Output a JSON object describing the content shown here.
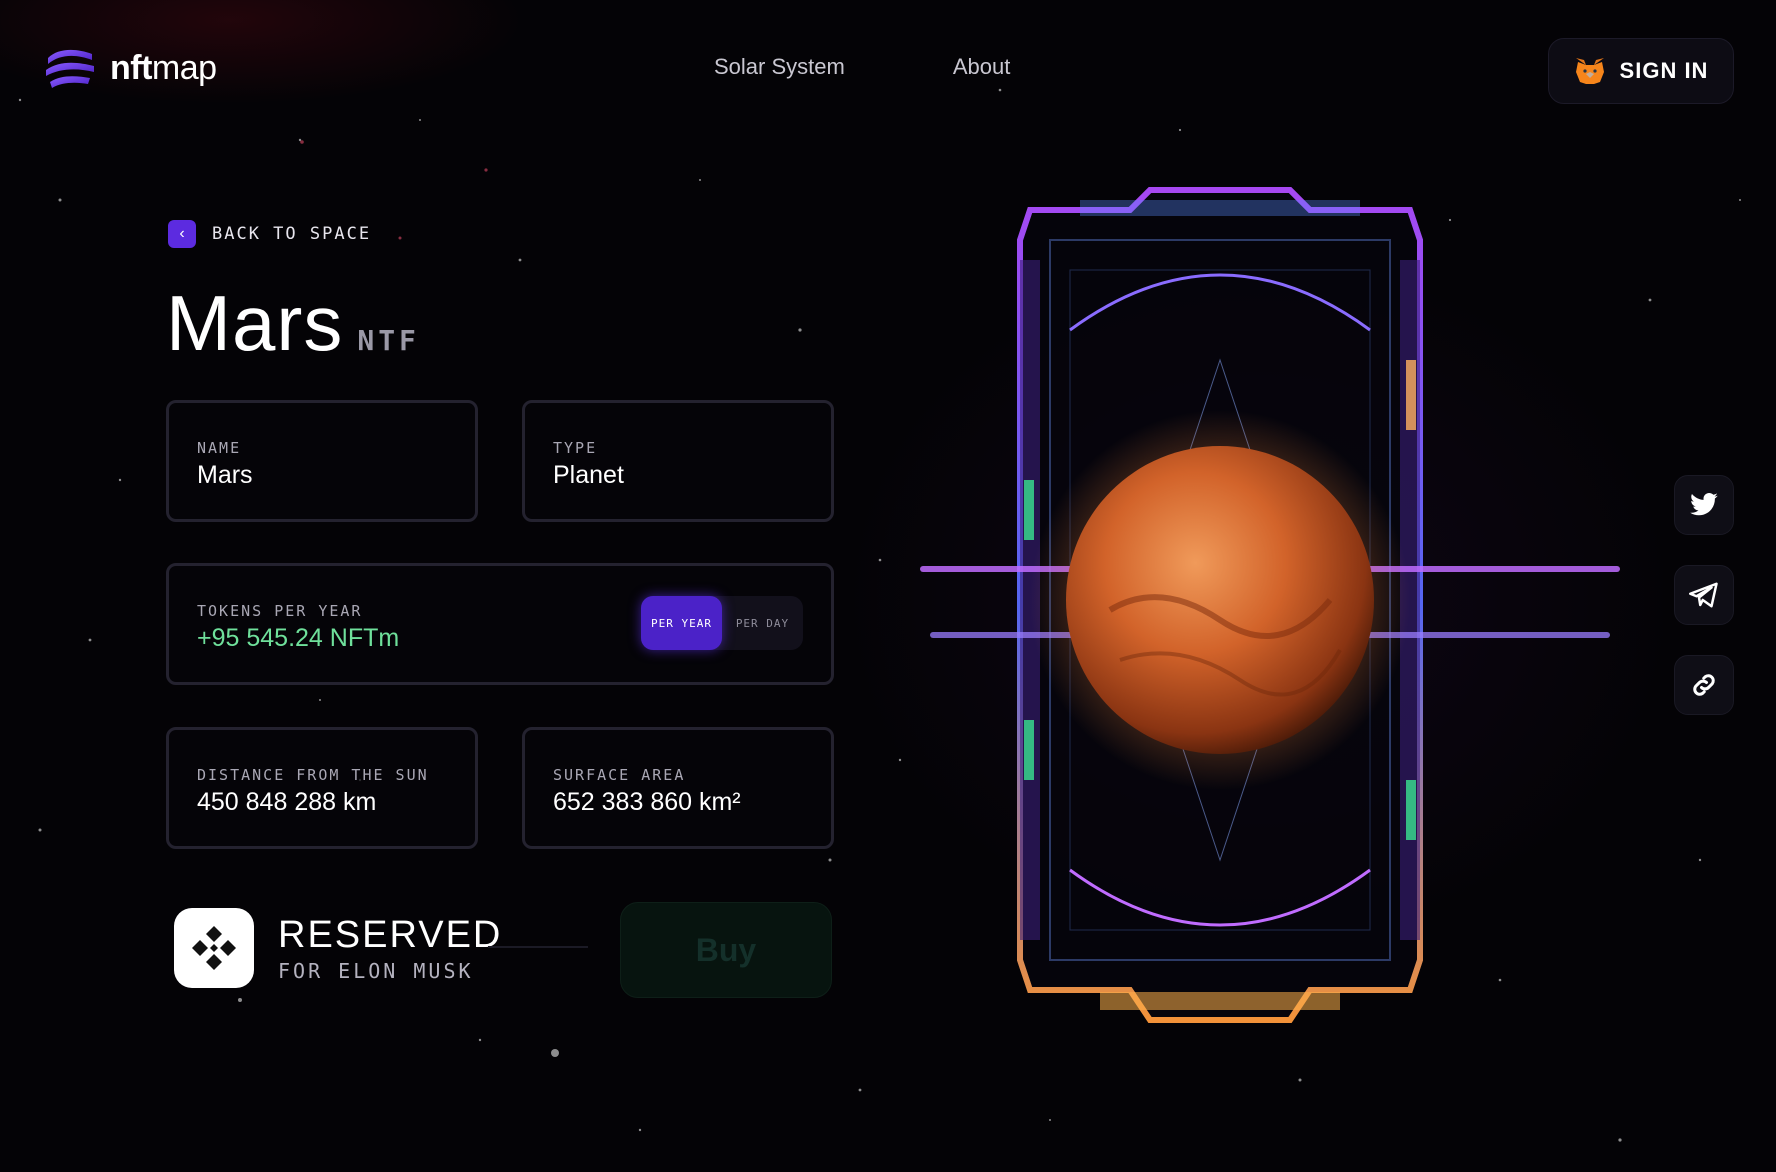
{
  "brand": {
    "name_bold": "nft",
    "name_light": "map"
  },
  "nav": {
    "items": [
      "Solar System",
      "About"
    ]
  },
  "header": {
    "signin_label": "SIGN IN"
  },
  "back": {
    "label": "BACK TO SPACE"
  },
  "planet": {
    "title": "Mars",
    "suffix": "NTF"
  },
  "fields": {
    "name": {
      "label": "NAME",
      "value": "Mars"
    },
    "type": {
      "label": "TYPE",
      "value": "Planet"
    },
    "tokens": {
      "label": "TOKENS PER YEAR",
      "value": "+95 545.24 NFTm"
    },
    "distance": {
      "label": "DISTANCE FROM THE SUN",
      "value": "450 848 288 km"
    },
    "surface": {
      "label": "SURFACE AREA",
      "value": "652 383 860 km²"
    }
  },
  "toggle": {
    "options": [
      "PER YEAR",
      "PER DAY"
    ],
    "selected": "PER YEAR"
  },
  "reserved": {
    "title": "RESERVED",
    "subtitle": "FOR ELON MUSK"
  },
  "buy": {
    "label": "Buy"
  },
  "social": {
    "icons": [
      "twitter-icon",
      "telegram-icon",
      "link-icon"
    ]
  },
  "colors": {
    "accent": "#5c2be0",
    "token_green": "#6fe09b",
    "planet": "#d2632a"
  }
}
